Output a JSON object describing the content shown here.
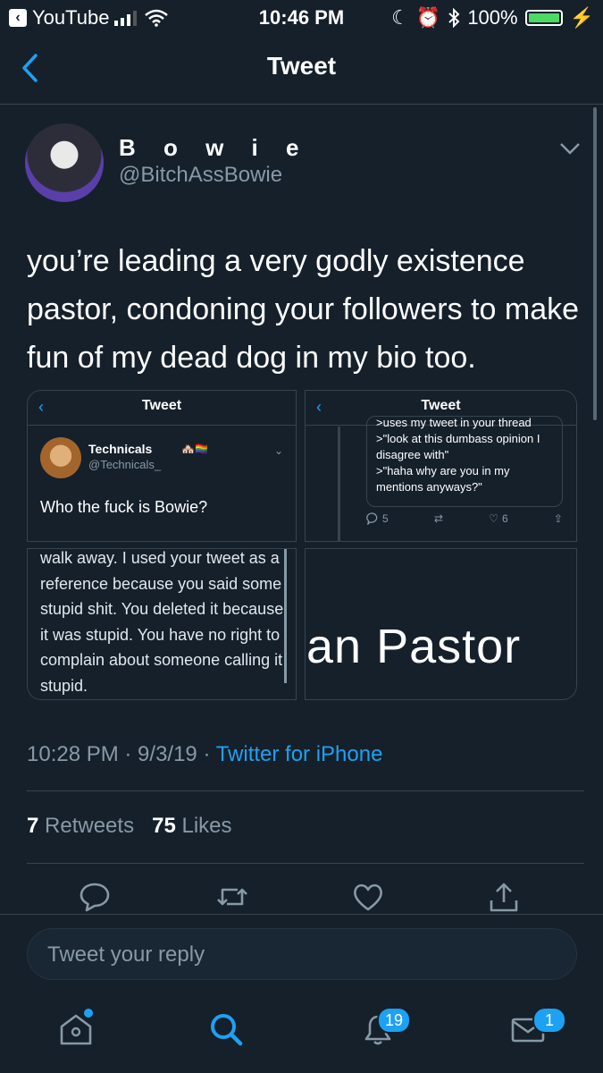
{
  "status_bar": {
    "back_app": "YouTube",
    "time": "10:46 PM",
    "battery": "100%"
  },
  "nav": {
    "title": "Tweet"
  },
  "tweet": {
    "author_name": "B o w i e",
    "author_handle": "@BitchAssBowie",
    "text": "you’re leading a very godly existence pastor, condoning your followers to make fun of my dead dog in my bio too.",
    "time": "10:28 PM · 9/3/19 · ",
    "source": "Twitter for iPhone",
    "retweets_count": "7",
    "retweets_label": " Retweets",
    "likes_count": "75",
    "likes_label": " Likes"
  },
  "media": {
    "cell1": {
      "title": "Tweet",
      "name": "Technicals",
      "flags": "🏘️🏳️‍🌈",
      "handle": "@Technicals_",
      "text": "Who the fuck is Bowie?"
    },
    "cell2": {
      "title": "Tweet",
      "quote": ">uses my tweet in your thread\n>\"look at this dumbass opinion I disagree with\"\n>\"haha why are you in my mentions anyways?\"",
      "replies": "5",
      "likes": "6"
    },
    "cell3": {
      "text": "walk away. I used your tweet as a reference because you said some stupid shit. You deleted it because it was stupid. You have no right to complain about someone calling it stupid."
    },
    "cell4": {
      "text": "ian Pastor"
    }
  },
  "reply": {
    "placeholder": "Tweet your reply"
  },
  "tabbar": {
    "notifications_badge": "19",
    "messages_badge": "1"
  },
  "colors": {
    "background": "#15202b",
    "accent": "#1da1f2",
    "muted": "#8899a6",
    "divider": "#38444d"
  }
}
